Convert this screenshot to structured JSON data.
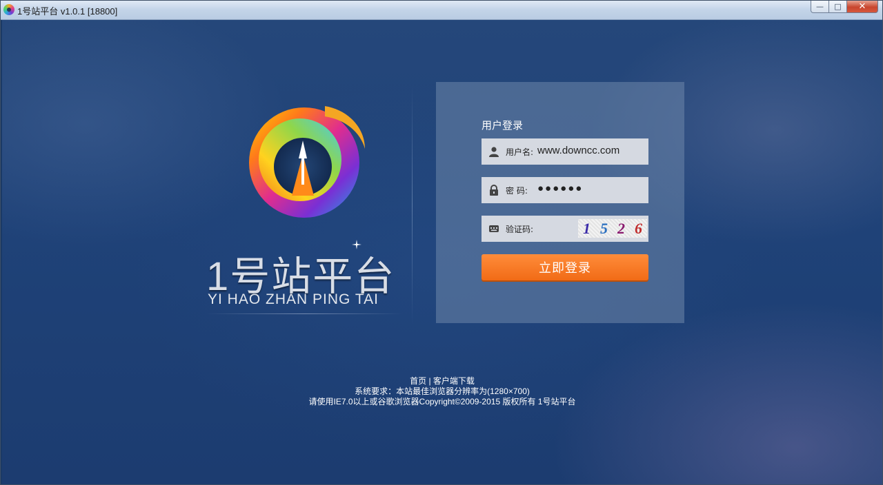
{
  "window": {
    "title": "1号站平台 v1.0.1 [18800]",
    "min_label": "—",
    "max_label": "□",
    "close_label": "✕"
  },
  "brand": {
    "name_cn": "1号站平台",
    "name_en": "YI HAO ZHAN PING TAI"
  },
  "login": {
    "title": "用户登录",
    "username_label": "用户名:",
    "username_value": "www.downcc.com",
    "password_label": "密 码:",
    "password_value": "●●●●●●",
    "captcha_label": "验证码:",
    "captcha_digits": [
      "1",
      "5",
      "2",
      "6"
    ],
    "captcha_colors": [
      "#3a2aa8",
      "#2a6fc0",
      "#8a1a6e",
      "#c02a2a"
    ],
    "submit_label": "立即登录"
  },
  "footer": {
    "home_link": "首页",
    "separator": "|",
    "download_link": "客户端下载",
    "requirements": "系统要求：本站最佳浏览器分辨率为(1280×700)",
    "copyright": "请使用IE7.0以上或谷歌浏览器Copyright©2009-2015 版权所有 1号站平台"
  },
  "colors": {
    "accent": "#f47a22",
    "background": "#1f4278",
    "panel": "#6e87aa"
  }
}
